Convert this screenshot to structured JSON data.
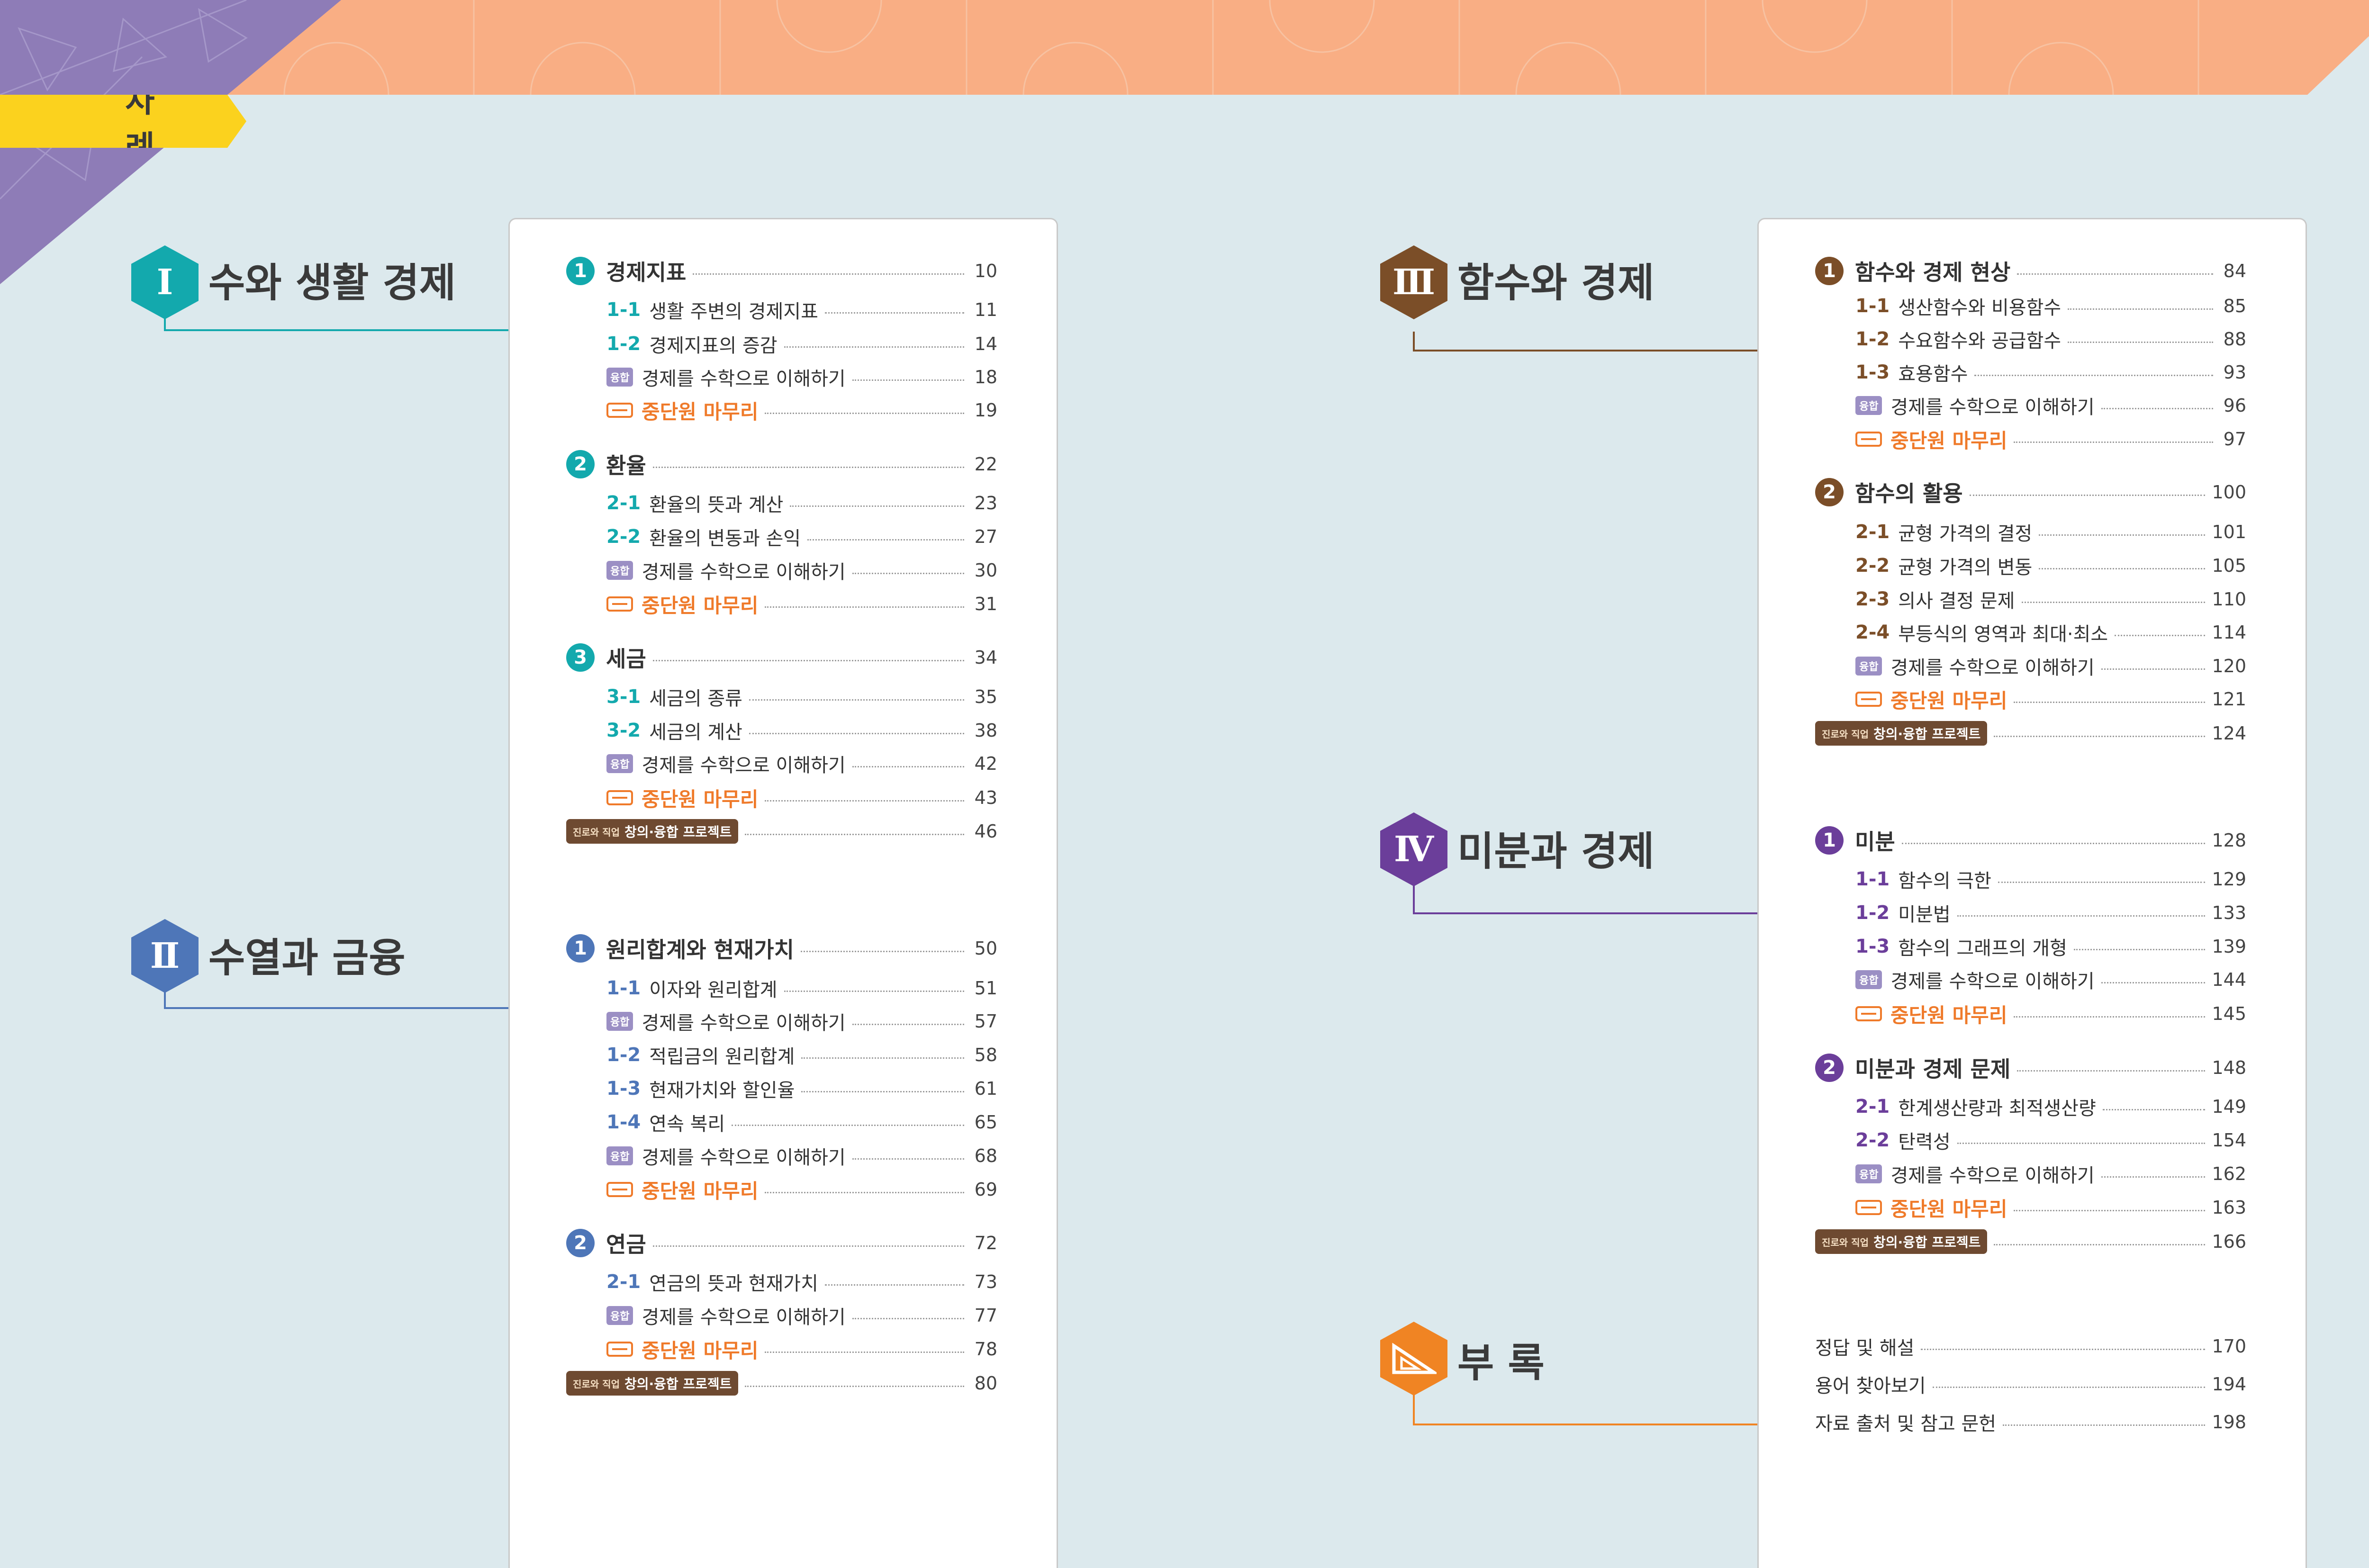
{
  "header": {
    "title": "차 례"
  },
  "colors": {
    "unit1": "#13a9ad",
    "unit2": "#4e76b8",
    "unit3": "#7b4e28",
    "unit4": "#6b3e9a",
    "appendix": "#f08423",
    "review": "#ef7a2a",
    "background": "#dce9ed",
    "header_band": "#f9ae84",
    "header_corner": "#8e7cb7"
  },
  "units": [
    {
      "numeral": "Ⅰ",
      "title": "수와 생활 경제"
    },
    {
      "numeral": "Ⅱ",
      "title": "수열과 금융"
    },
    {
      "numeral": "Ⅲ",
      "title": "함수와 경제"
    },
    {
      "numeral": "Ⅳ",
      "title": "미분과 경제"
    },
    {
      "numeral": "△",
      "title": "부 록",
      "icon": "set-square-icon"
    }
  ],
  "common": {
    "app_tag": "융합",
    "app_label": "경제를 수학으로 이해하기",
    "review_label": "중단원 마무리",
    "project_small": "진로와 직업",
    "project_big": "창의·융합 프로젝트"
  },
  "toc": {
    "u1": {
      "c1": {
        "num": "1",
        "title": "경제지표",
        "page": "10",
        "s1": {
          "num": "1-1",
          "title": "생활 주변의 경제지표",
          "page": "11"
        },
        "s2": {
          "num": "1-2",
          "title": "경제지표의 증감",
          "page": "14"
        },
        "app": "18",
        "review": "19"
      },
      "c2": {
        "num": "2",
        "title": "환율",
        "page": "22",
        "s1": {
          "num": "2-1",
          "title": "환율의 뜻과 계산",
          "page": "23"
        },
        "s2": {
          "num": "2-2",
          "title": "환율의 변동과 손익",
          "page": "27"
        },
        "app": "30",
        "review": "31"
      },
      "c3": {
        "num": "3",
        "title": "세금",
        "page": "34",
        "s1": {
          "num": "3-1",
          "title": "세금의 종류",
          "page": "35"
        },
        "s2": {
          "num": "3-2",
          "title": "세금의 계산",
          "page": "38"
        },
        "app": "42",
        "review": "43"
      },
      "project": "46"
    },
    "u2": {
      "c1": {
        "num": "1",
        "title": "원리합계와 현재가치",
        "page": "50",
        "s1": {
          "num": "1-1",
          "title": "이자와 원리합계",
          "page": "51"
        },
        "app1": "57",
        "s2": {
          "num": "1-2",
          "title": "적립금의 원리합계",
          "page": "58"
        },
        "s3": {
          "num": "1-3",
          "title": "현재가치와 할인율",
          "page": "61"
        },
        "s4": {
          "num": "1-4",
          "title": "연속 복리",
          "page": "65"
        },
        "app2": "68",
        "review": "69"
      },
      "c2": {
        "num": "2",
        "title": "연금",
        "page": "72",
        "s1": {
          "num": "2-1",
          "title": "연금의 뜻과 현재가치",
          "page": "73"
        },
        "app": "77",
        "review": "78"
      },
      "project": "80"
    },
    "u3": {
      "c1": {
        "num": "1",
        "title": "함수와 경제 현상",
        "page": "84",
        "s1": {
          "num": "1-1",
          "title": "생산함수와 비용함수",
          "page": "85"
        },
        "s2": {
          "num": "1-2",
          "title": "수요함수와 공급함수",
          "page": "88"
        },
        "s3": {
          "num": "1-3",
          "title": "효용함수",
          "page": "93"
        },
        "app": "96",
        "review": "97"
      },
      "c2": {
        "num": "2",
        "title": "함수의 활용",
        "page": "100",
        "s1": {
          "num": "2-1",
          "title": "균형 가격의 결정",
          "page": "101"
        },
        "s2": {
          "num": "2-2",
          "title": "균형 가격의 변동",
          "page": "105"
        },
        "s3": {
          "num": "2-3",
          "title": "의사 결정 문제",
          "page": "110"
        },
        "s4": {
          "num": "2-4",
          "title": "부등식의 영역과 최대·최소",
          "page": "114"
        },
        "app": "120",
        "review": "121"
      },
      "project": "124"
    },
    "u4": {
      "c1": {
        "num": "1",
        "title": "미분",
        "page": "128",
        "s1": {
          "num": "1-1",
          "title": "함수의 극한",
          "page": "129"
        },
        "s2": {
          "num": "1-2",
          "title": "미분법",
          "page": "133"
        },
        "s3": {
          "num": "1-3",
          "title": "함수의 그래프의 개형",
          "page": "139"
        },
        "app": "144",
        "review": "145"
      },
      "c2": {
        "num": "2",
        "title": "미분과 경제 문제",
        "page": "148",
        "s1": {
          "num": "2-1",
          "title": "한계생산량과 최적생산량",
          "page": "149"
        },
        "s2": {
          "num": "2-2",
          "title": "탄력성",
          "page": "154"
        },
        "app": "162",
        "review": "163"
      },
      "project": "166"
    },
    "appendix": [
      {
        "title": "정답 및 해설",
        "page": "170"
      },
      {
        "title": "용어 찾아보기",
        "page": "194"
      },
      {
        "title": "자료 출처 및 참고 문헌",
        "page": "198"
      }
    ]
  }
}
